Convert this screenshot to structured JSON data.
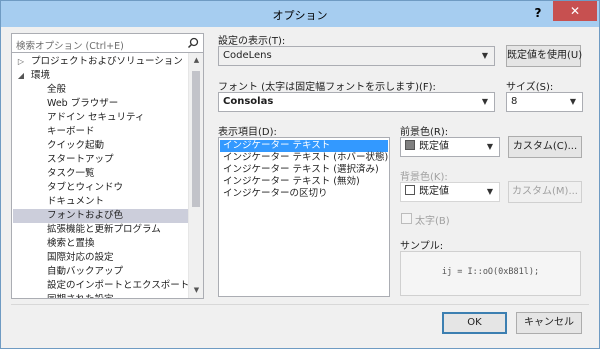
{
  "window": {
    "title": "オプション",
    "help": "?",
    "close": "✕"
  },
  "search": {
    "placeholder": "検索オプション (Ctrl+E)"
  },
  "tree": {
    "items": [
      {
        "label": "プロジェクトおよびソリューション",
        "indent": 0,
        "arrow": "▷"
      },
      {
        "label": "環境",
        "indent": 0,
        "arrow": "◢"
      },
      {
        "label": "全般",
        "indent": 1
      },
      {
        "label": "Web ブラウザー",
        "indent": 1
      },
      {
        "label": "アドイン セキュリティ",
        "indent": 1
      },
      {
        "label": "キーボード",
        "indent": 1
      },
      {
        "label": "クイック起動",
        "indent": 1
      },
      {
        "label": "スタートアップ",
        "indent": 1
      },
      {
        "label": "タスク一覧",
        "indent": 1
      },
      {
        "label": "タブとウィンドウ",
        "indent": 1
      },
      {
        "label": "ドキュメント",
        "indent": 1
      },
      {
        "label": "フォントおよび色",
        "indent": 1,
        "selected": true
      },
      {
        "label": "拡張機能と更新プログラム",
        "indent": 1
      },
      {
        "label": "検索と置換",
        "indent": 1
      },
      {
        "label": "国際対応の設定",
        "indent": 1
      },
      {
        "label": "自動バックアップ",
        "indent": 1
      },
      {
        "label": "設定のインポートとエクスポート",
        "indent": 1
      },
      {
        "label": "同期された設定",
        "indent": 1
      }
    ]
  },
  "settings": {
    "show_label": "設定の表示(T):",
    "show_value": "CodeLens",
    "default_button": "既定値を使用(U)",
    "font_label": "フォント (太字は固定幅フォントを示します)(F):",
    "font_value": "Consolas",
    "size_label": "サイズ(S):",
    "size_value": "8",
    "items_label": "表示項目(D):",
    "items": [
      "インジケーター テキスト",
      "インジケーター テキスト (ホバー状態)",
      "インジケーター テキスト (選択済み)",
      "インジケーター テキスト (無効)",
      "インジケーターの区切り"
    ],
    "selected_item_index": 0,
    "foreground_label": "前景色(R):",
    "foreground_value": "既定値",
    "foreground_color": "#808080",
    "custom_fg_button": "カスタム(C)...",
    "background_label": "背景色(K):",
    "background_value": "既定値",
    "background_color": "#ffffff",
    "custom_bg_button": "カスタム(M)...",
    "bold_label": "太字(B)",
    "sample_label": "サンプル:",
    "sample_text": "ij = I::oO(0xB81l);"
  },
  "footer": {
    "ok": "OK",
    "cancel": "キャンセル"
  },
  "colors": {
    "titlebar": "#a6cdf0",
    "close": "#c75050",
    "selection": "#3399ff",
    "tree_selection": "#cccedb"
  }
}
